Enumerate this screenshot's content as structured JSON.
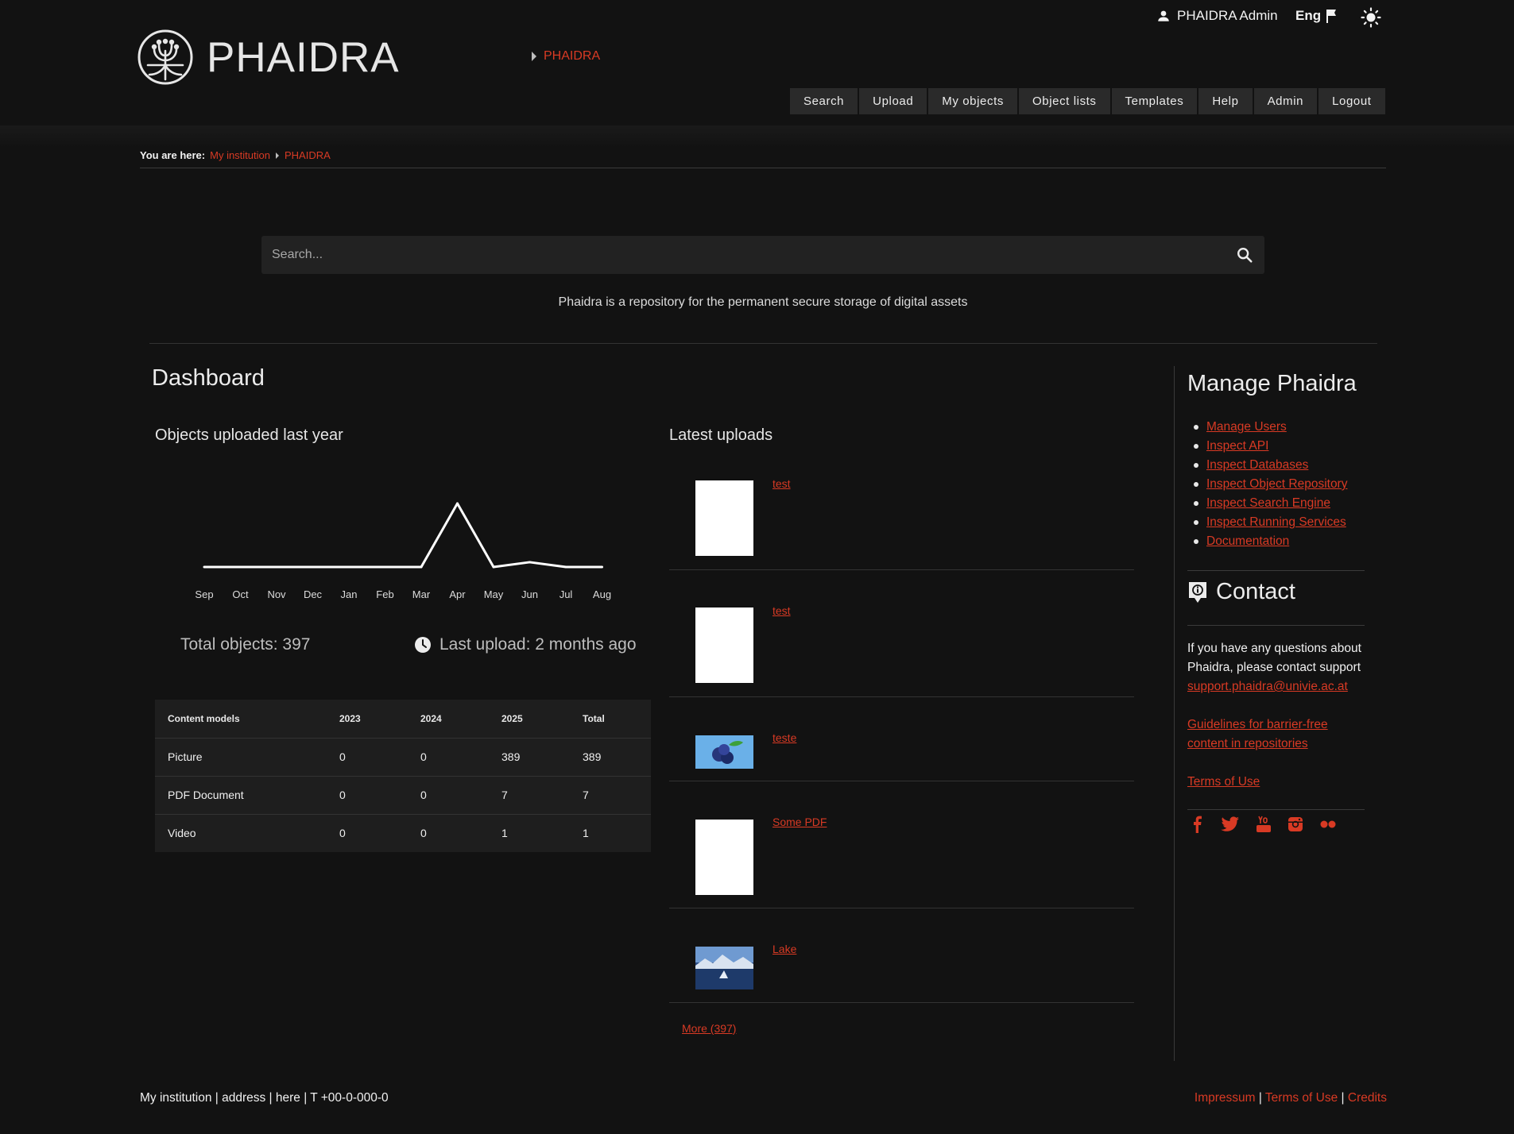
{
  "topbar": {
    "user_name": "PHAIDRA Admin",
    "language": "Eng"
  },
  "brand": {
    "title": "PHAIDRA",
    "crumb": "PHAIDRA"
  },
  "nav": [
    "Search",
    "Upload",
    "My objects",
    "Object lists",
    "Templates",
    "Help",
    "Admin",
    "Logout"
  ],
  "breadcrumb": {
    "label": "You are here:",
    "items": [
      "My institution",
      "PHAIDRA"
    ]
  },
  "search": {
    "placeholder": "Search..."
  },
  "tagline": "Phaidra is a repository for the permanent secure storage of digital assets",
  "dashboard": {
    "title": "Dashboard",
    "chart_title": "Objects uploaded last year",
    "total_objects": "Total objects: 397",
    "last_upload": "Last upload: 2 months ago",
    "table": {
      "headers": [
        "Content models",
        "2023",
        "2024",
        "2025",
        "Total"
      ],
      "rows": [
        [
          "Picture",
          "0",
          "0",
          "389",
          "389"
        ],
        [
          "PDF Document",
          "0",
          "0",
          "7",
          "7"
        ],
        [
          "Video",
          "0",
          "0",
          "1",
          "1"
        ]
      ]
    }
  },
  "chart_data": {
    "type": "line",
    "categories": [
      "Sep",
      "Oct",
      "Nov",
      "Dec",
      "Jan",
      "Feb",
      "Mar",
      "Apr",
      "May",
      "Jun",
      "Jul",
      "Aug"
    ],
    "series": [
      {
        "values": [
          0,
          0,
          0,
          0,
          0,
          0,
          0,
          330,
          0,
          25,
          0,
          0
        ]
      }
    ],
    "title": "Objects uploaded last year",
    "xlabel": "",
    "ylabel": "",
    "ylim": [
      0,
      330
    ],
    "grid": false,
    "color": "#ffffff"
  },
  "latest": {
    "title": "Latest uploads",
    "items": [
      {
        "title": "test",
        "thumb": "pdf-page"
      },
      {
        "title": "test",
        "thumb": "pdf-page"
      },
      {
        "title": "teste",
        "thumb": "blueberries-image"
      },
      {
        "title": "Some PDF",
        "thumb": "pdf-page"
      },
      {
        "title": "Lake",
        "thumb": "lake-image"
      }
    ],
    "more": "More (397)"
  },
  "sidebar": {
    "manage_title": "Manage Phaidra",
    "manage_links": [
      "Manage Users",
      "Inspect API",
      "Inspect Databases",
      "Inspect Object Repository",
      "Inspect Search Engine",
      "Inspect Running Services",
      "Documentation"
    ],
    "contact_title": "Contact",
    "contact_text": "If you have any questions about Phaidra, please contact support",
    "contact_email": "support.phaidra@univie.ac.at",
    "guidelines": "Guidelines for barrier-free content in repositories",
    "terms": "Terms of Use",
    "social_icons": [
      "facebook-icon",
      "twitter-icon",
      "youtube-icon",
      "instagram-icon",
      "flickr-icon"
    ]
  },
  "footer": {
    "left": "My institution | address | here | T +00-0-000-0",
    "links": [
      "Impressum",
      "Terms of Use",
      "Credits"
    ]
  },
  "colors": {
    "background": "#121212",
    "accent": "#d83a24",
    "button": "#2a2a2a"
  }
}
